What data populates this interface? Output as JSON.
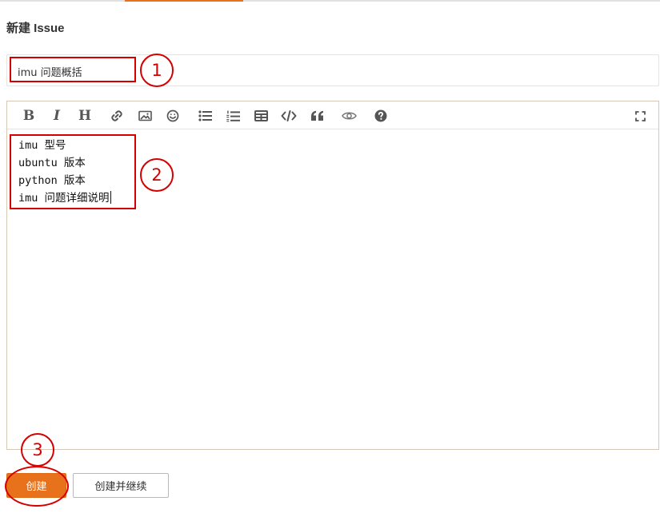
{
  "page": {
    "title": "新建 Issue"
  },
  "issue_title": {
    "value": "imu 问题概括"
  },
  "toolbar": {
    "items": [
      {
        "name": "bold",
        "glyph": "B"
      },
      {
        "name": "italic",
        "glyph": "I"
      },
      {
        "name": "heading",
        "glyph": "H"
      },
      {
        "name": "link-icon"
      },
      {
        "name": "image-icon"
      },
      {
        "name": "emoji-icon"
      },
      {
        "name": "bullet-list-icon"
      },
      {
        "name": "ordered-list-icon"
      },
      {
        "name": "table-icon"
      },
      {
        "name": "code-icon"
      },
      {
        "name": "quote-icon"
      },
      {
        "name": "preview-eye-icon"
      },
      {
        "name": "help-icon"
      },
      {
        "name": "fullscreen-icon"
      }
    ]
  },
  "editor": {
    "lines": [
      "imu 型号",
      "ubuntu 版本",
      "python 版本",
      "imu 问题详细说明"
    ]
  },
  "buttons": {
    "create": "创建",
    "create_continue": "创建并继续"
  },
  "annotations": {
    "one": "1",
    "two": "2",
    "three": "3"
  },
  "colors": {
    "accent": "#e8721c",
    "annotation": "#d40000"
  }
}
